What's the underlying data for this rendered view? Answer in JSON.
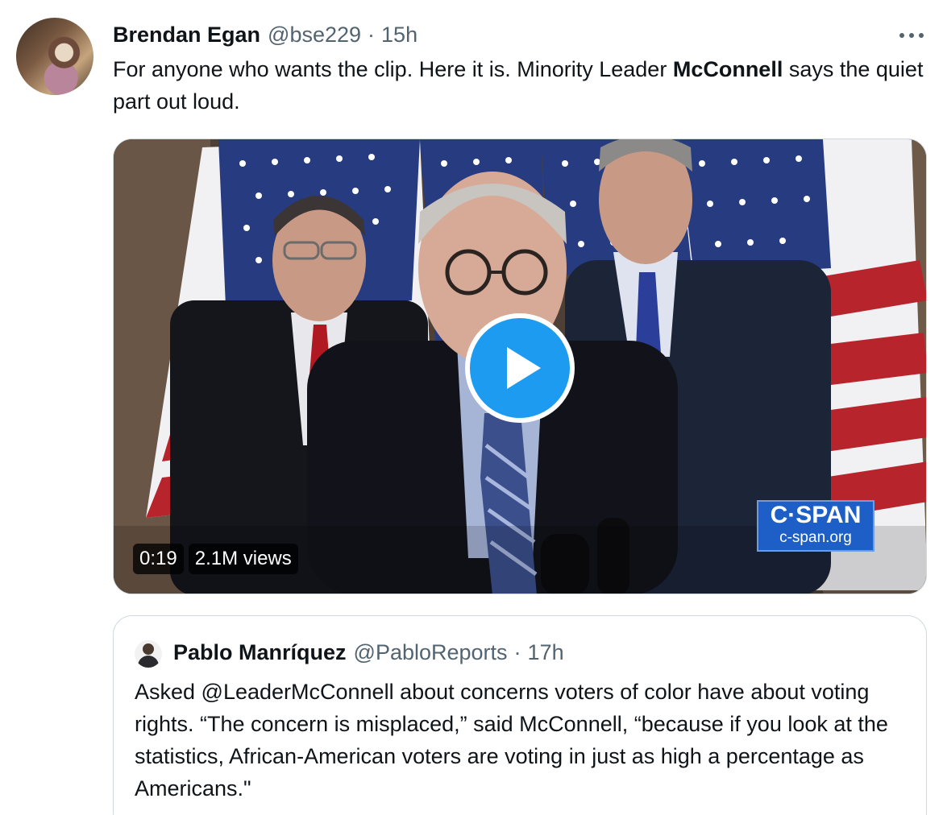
{
  "tweet": {
    "display_name": "Brendan Egan",
    "handle": "@bse229",
    "separator": "·",
    "time": "15h",
    "text_before": "For anyone who wants the clip. Here it is. Minority Leader ",
    "text_bold": "McConnell",
    "text_after": " says the quiet part out loud.",
    "more_icon": "more-horizontal-icon"
  },
  "video": {
    "duration": "0:19",
    "views": "2.1M views",
    "play_icon": "play-icon",
    "watermark_logo": "C·SPAN",
    "watermark_url": "c-span.org",
    "accent_color": "#1d9bf0"
  },
  "quoted_tweet": {
    "display_name": "Pablo Manríquez",
    "handle": "@PabloReports",
    "separator": "·",
    "time": "17h",
    "text": "Asked @LeaderMcConnell about concerns voters of color have about voting rights. “The concern is misplaced,” said McConnell, “because if you look at the statistics, African-American voters are voting in just as high a percentage as Americans.\""
  }
}
